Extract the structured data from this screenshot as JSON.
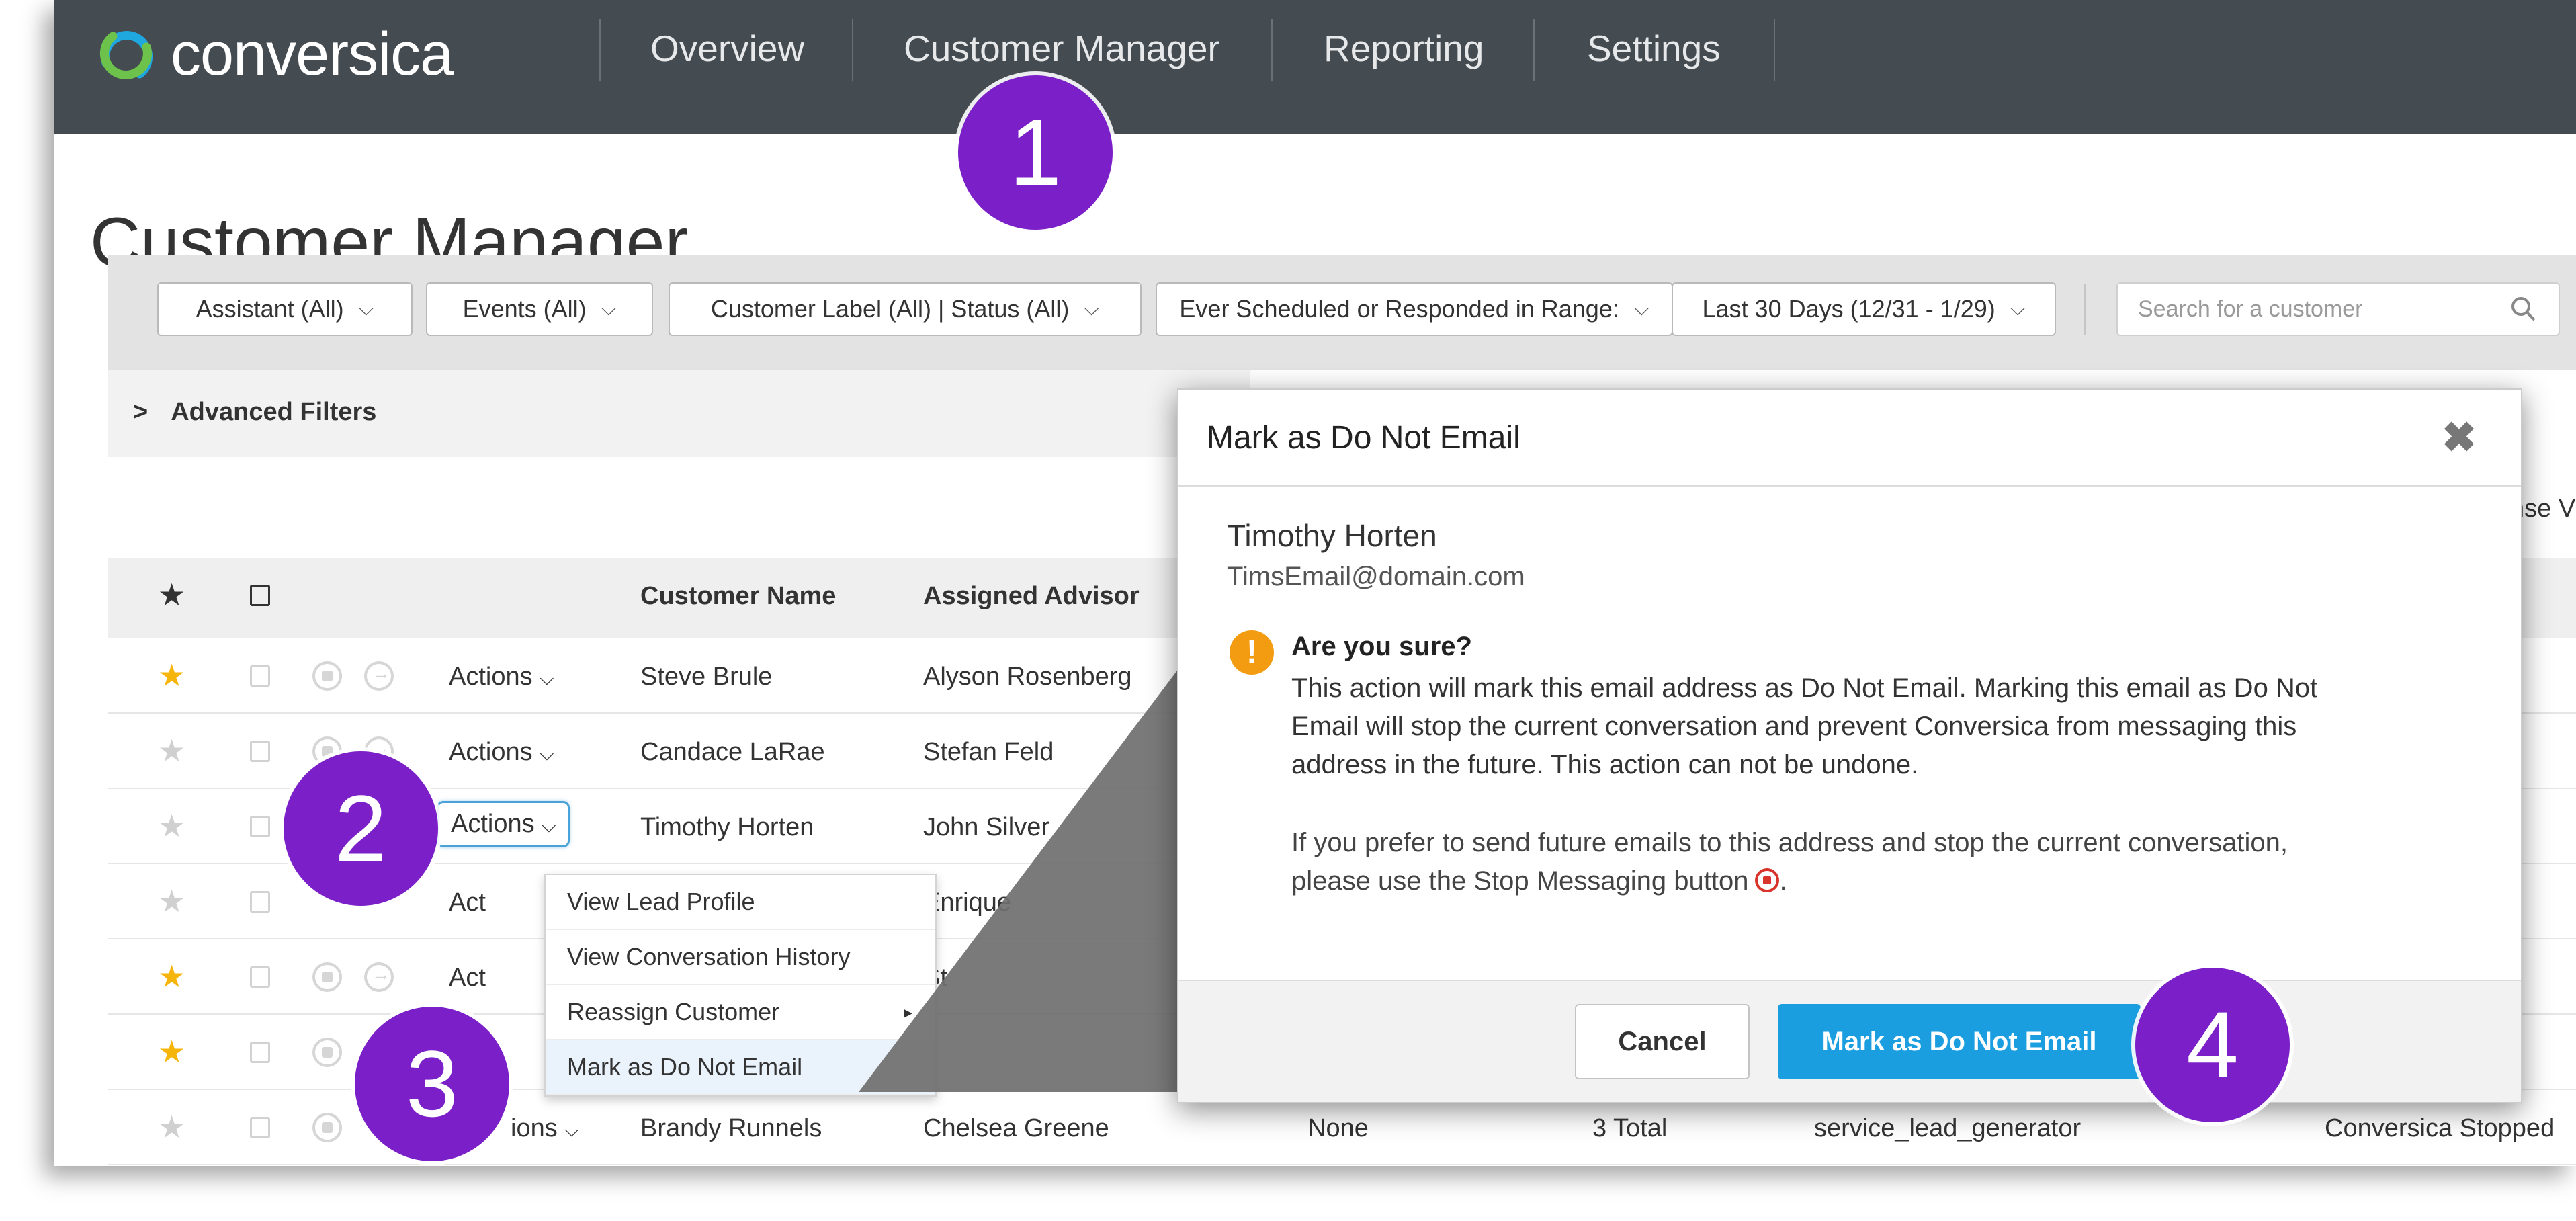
{
  "app": {
    "logo_text": "conversica"
  },
  "nav": {
    "items": [
      "Overview",
      "Customer Manager",
      "Reporting",
      "Settings"
    ]
  },
  "page_title": "Customer Manager",
  "filters": {
    "assistant": "Assistant (All)",
    "events": "Events (All)",
    "label_status": "Customer Label (All) | Status (All)",
    "range": "Ever Scheduled or Responded in Range:",
    "dates": "Last 30 Days (12/31 - 1/29)",
    "search_placeholder": "Search for a customer",
    "advanced": "Advanced Filters"
  },
  "partial_header": "nse V",
  "table": {
    "headers": {
      "customer_name": "Customer Name",
      "assigned_advisor": "Assigned Advisor"
    },
    "rows": [
      {
        "starred": true,
        "actions": "Actions",
        "name": "Steve Brule",
        "advisor": "Alyson Rosenberg"
      },
      {
        "starred": false,
        "actions": "Actions",
        "name": "Candace LaRae",
        "advisor": "Stefan Feld"
      },
      {
        "starred": false,
        "actions": "Actions",
        "name": "Timothy Horten",
        "advisor": "John Silver"
      },
      {
        "starred": false,
        "actions": "Act",
        "name": "",
        "advisor": "Enrique"
      },
      {
        "starred": true,
        "actions": "Act",
        "name": "",
        "advisor": "St"
      },
      {
        "starred": true,
        "actions": "",
        "name": "",
        "advisor": ""
      },
      {
        "starred": false,
        "actions": "ions",
        "name": "Brandy Runnels",
        "advisor": "Chelsea Greene",
        "c5": "None",
        "c6": "3 Total",
        "c7": "service_lead_generator",
        "c8": "Conversica Stopped"
      }
    ]
  },
  "dropdown": {
    "items": [
      "View Lead Profile",
      "View Conversation History",
      "Reassign Customer",
      "Mark as Do Not Email"
    ]
  },
  "modal": {
    "title": "Mark as Do Not Email",
    "close": "✖",
    "customer_name": "Timothy Horten",
    "customer_email": "TimsEmail@domain.com",
    "warning_title": "Are you sure?",
    "warning_text": "This action will mark this email address as Do Not Email. Marking this email as Do Not Email will stop the current conversation and prevent Conversica from messaging this address in the future. This action can not be undone.",
    "note_text": "If you prefer to send future emails to this address and stop the current conversation, please use the Stop Messaging button",
    "cancel": "Cancel",
    "confirm": "Mark as Do Not Email"
  },
  "markers": [
    "1",
    "2",
    "3",
    "4"
  ],
  "colors": {
    "nav_bg": "#444c52",
    "marker": "#7b1fc8",
    "primary": "#1a9ee0",
    "star": "#f6b50a",
    "warning": "#f39c12",
    "stop": "#d9342b"
  }
}
